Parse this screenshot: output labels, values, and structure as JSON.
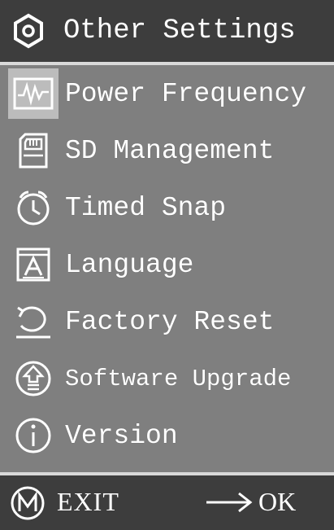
{
  "header": {
    "title": "Other Settings",
    "icon": "settings-hexagon-icon"
  },
  "menu": {
    "items": [
      {
        "label": "Power Frequency",
        "icon": "waveform-icon",
        "selected": true
      },
      {
        "label": "SD Management",
        "icon": "sd-card-icon",
        "selected": false
      },
      {
        "label": "Timed Snap",
        "icon": "clock-icon",
        "selected": false
      },
      {
        "label": "Language",
        "icon": "language-a-icon",
        "selected": false
      },
      {
        "label": "Factory Reset",
        "icon": "reset-icon",
        "selected": false
      },
      {
        "label": "Software Upgrade",
        "icon": "upgrade-icon",
        "selected": false
      },
      {
        "label": "Version",
        "icon": "info-icon",
        "selected": false
      }
    ]
  },
  "footer": {
    "exit_label": "EXIT",
    "ok_label": "OK",
    "m_icon": "m-button-icon",
    "arrow_icon": "arrow-right-icon"
  },
  "colors": {
    "background": "#7f7f7f",
    "header": "#3d3d3d",
    "selected_highlight": "#bcbcbc",
    "text": "#ffffff"
  }
}
